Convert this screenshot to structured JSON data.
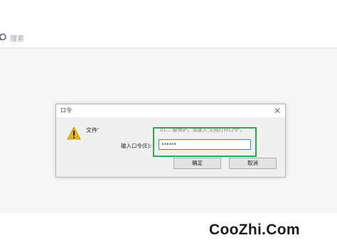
{
  "toolbar": {
    "search_label": "搜索"
  },
  "dialog": {
    "title": "口令",
    "close_glyph": "✕",
    "file_label": "文件'",
    "message": "01...'被保护。请键入'文档打开口令'。",
    "password_label": "输入口令(E):",
    "password_value": "******",
    "ok_label": "确定",
    "cancel_label": "取消"
  },
  "watermark": "CooZhi.Com",
  "colors": {
    "highlight": "#2ea84a",
    "input_focus": "#3c86d6",
    "warning": "#e8b60c"
  },
  "icons": {
    "search": "search-icon",
    "warning": "warning-icon",
    "close": "close-icon"
  }
}
